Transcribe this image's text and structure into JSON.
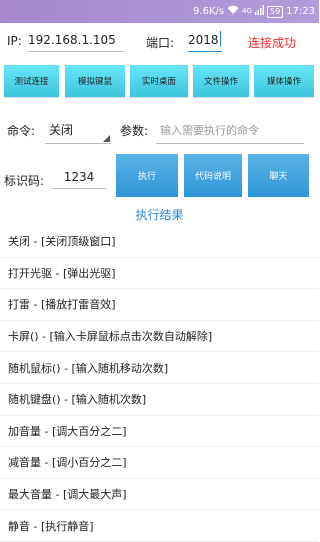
{
  "status_bar": {
    "net_speed": "9.6K/s",
    "network_type": "4G",
    "battery": "59",
    "time": "17:23",
    "color": "#a588cf"
  },
  "connection": {
    "ip_label": "IP:",
    "ip_value": "192.168.1.105",
    "port_label": "端口:",
    "port_value": "2018",
    "status": "连接成功",
    "status_color": "#ff2a2a"
  },
  "action_buttons": [
    {
      "label": "测试连接"
    },
    {
      "label": "模拟键鼠"
    },
    {
      "label": "实时桌面"
    },
    {
      "label": "文件操作"
    },
    {
      "label": "媒体操作"
    }
  ],
  "command": {
    "label": "命令:",
    "selected": "关闭",
    "param_label": "参数:",
    "param_placeholder": "输入需要执行的命令"
  },
  "identity": {
    "label": "标识码:",
    "value": "1234",
    "execute_label": "执行",
    "code_help_label": "代码说明",
    "chat_label": "聊天"
  },
  "result_title": "执行结果",
  "command_list": [
    "关闭 - [关闭顶级窗口]",
    "打开光驱 - [弹出光驱]",
    "打雷 - [播放打雷音效]",
    "卡屏() - [输入卡屏鼠标点击次数自动解除]",
    "随机鼠标() - [输入随机移动次数]",
    "随机键盘() - [输入随机次数]",
    "加音量 - [调大百分之二]",
    "减音量 - [调小百分之二]",
    "最大音量 - [调大最大声]",
    "静音 - [执行静音]"
  ]
}
